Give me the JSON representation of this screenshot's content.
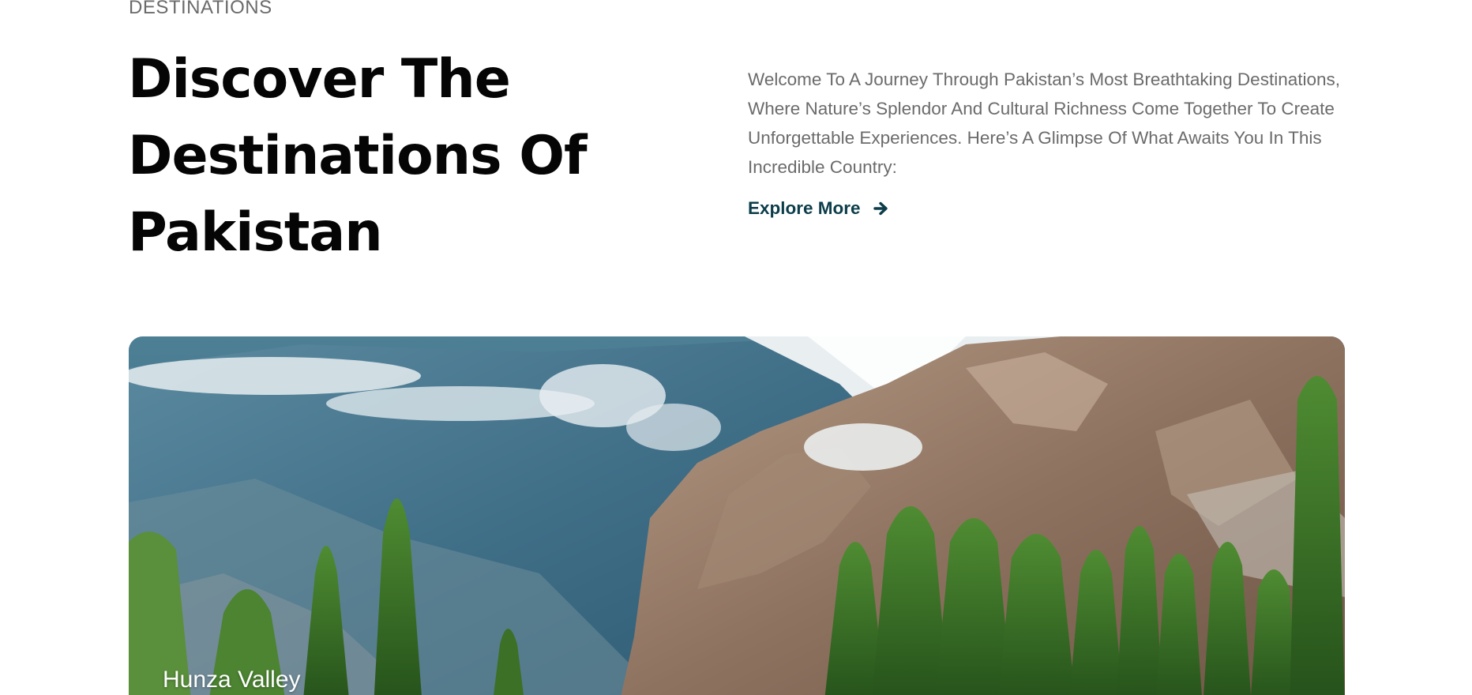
{
  "section": {
    "eyebrow": "DESTINATIONS",
    "title_line1": "Discover The",
    "title_line2": "Destinations Of",
    "title_line3": "Pakistan",
    "intro": "Welcome To A Journey Through Pakistan’s Most Breathtaking Destinations, Where Nature’s Splendor And Cultural Richness Come Together To Create Unforgettable Experiences. Here’s A Glimpse Of What Awaits You In This Incredible Country:",
    "explore_label": "Explore More",
    "explore_icon": "arrow-right-icon"
  },
  "destination_card": {
    "label": "Hunza Valley",
    "image": "mountain-valley-photo"
  },
  "colors": {
    "heading": "#050505",
    "body_text": "#6b6b6b",
    "link": "#0c3d4a",
    "background": "#ffffff"
  }
}
